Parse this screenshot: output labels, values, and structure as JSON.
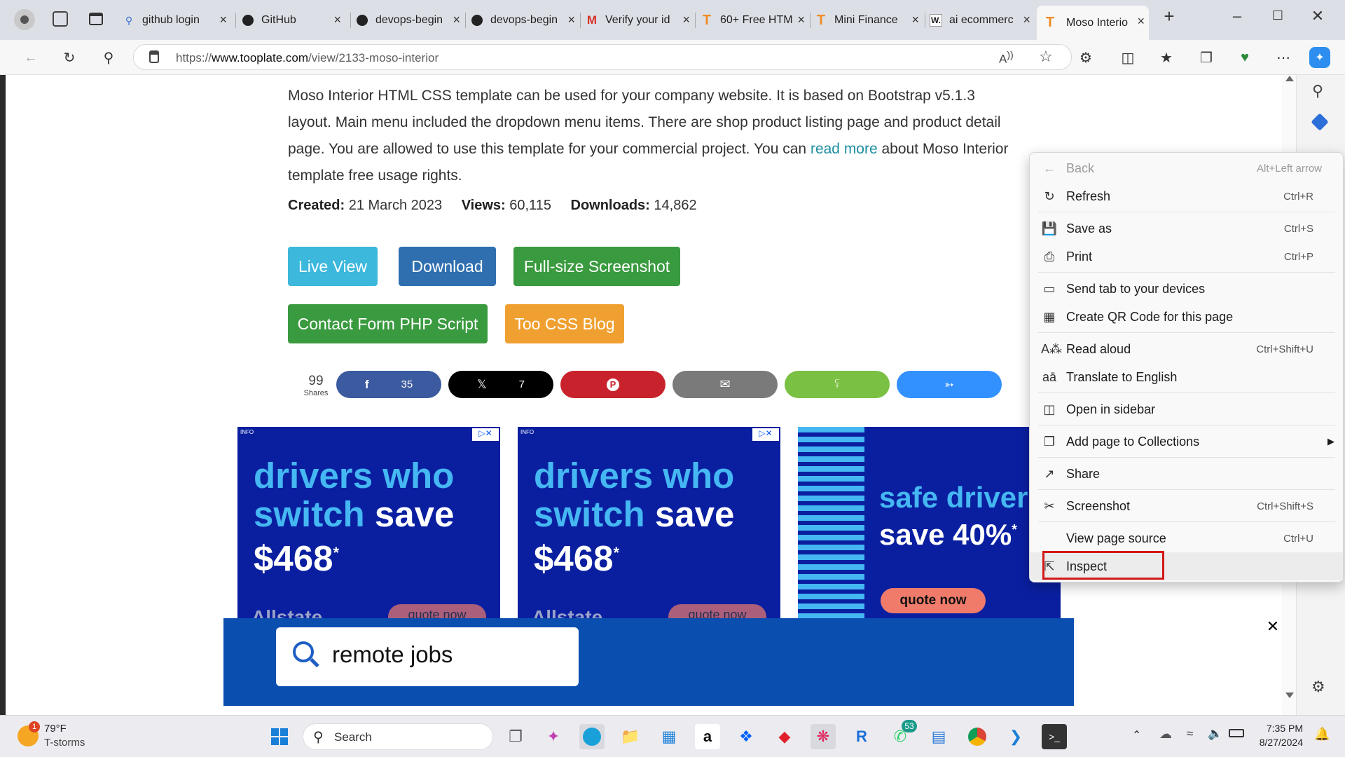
{
  "browser": {
    "tabs": [
      {
        "title": "github login",
        "favicon": "search-icon"
      },
      {
        "title": "GitHub",
        "favicon": "github-icon"
      },
      {
        "title": "devops-begin",
        "favicon": "github-icon"
      },
      {
        "title": "devops-begin",
        "favicon": "github-icon"
      },
      {
        "title": "Verify your id",
        "favicon": "gmail-icon"
      },
      {
        "title": "60+ Free HTM",
        "favicon": "tooplate-icon"
      },
      {
        "title": "Mini Finance",
        "favicon": "tooplate-icon"
      },
      {
        "title": "ai ecommerc",
        "favicon": "w-icon"
      },
      {
        "title": "Moso Interio",
        "favicon": "tooplate-icon",
        "active": true
      }
    ],
    "url_prefix": "https://",
    "url_host": "www.tooplate.com",
    "url_path": "/view/2133-moso-interior"
  },
  "page": {
    "description_1": "Moso Interior HTML CSS template can be used for your company website. It is based on Bootstrap v5.1.3 layout. Main menu included the dropdown menu items. There are shop product listing page and product detail page. You are allowed to use this template for your commercial project. You can ",
    "description_link": "read more",
    "description_2": " about Moso Interior template free usage rights.",
    "created_label": "Created:",
    "created_value": "21 March 2023",
    "views_label": "Views:",
    "views_value": "60,115",
    "downloads_label": "Downloads:",
    "downloads_value": "14,862",
    "buttons": {
      "live_view": "Live View",
      "download": "Download",
      "screenshot": "Full-size Screenshot",
      "contact_form": "Contact Form PHP Script",
      "blog": "Too CSS Blog"
    },
    "share": {
      "total": "99",
      "total_label": "Shares",
      "facebook_count": "35",
      "x_count": "7"
    },
    "ads": [
      {
        "info": "INFO",
        "line1": "drivers who",
        "line2a": "switch",
        "line2b": "save",
        "line3": "$468",
        "sup": "*",
        "brand": "Allstate",
        "cta": "quote now"
      },
      {
        "info": "INFO",
        "line1": "drivers who",
        "line2a": "switch",
        "line2b": "save",
        "line3": "$468",
        "sup": "*",
        "brand": "Allstate",
        "cta": "quote now"
      },
      {
        "line1": "safe driver",
        "line2": "save 40%",
        "sup": "*",
        "cta": "quote now"
      }
    ],
    "bottom_ad": {
      "query": "remote jobs"
    }
  },
  "context_menu": [
    {
      "icon": "back-arrow-icon",
      "label": "Back",
      "shortcut": "Alt+Left arrow",
      "disabled": true
    },
    {
      "icon": "refresh-icon",
      "label": "Refresh",
      "shortcut": "Ctrl+R"
    },
    {
      "icon": "save-icon",
      "label": "Save as",
      "shortcut": "Ctrl+S"
    },
    {
      "icon": "print-icon",
      "label": "Print",
      "shortcut": "Ctrl+P"
    },
    {
      "icon": "send-tab-icon",
      "label": "Send tab to your devices",
      "shortcut": ""
    },
    {
      "icon": "qr-code-icon",
      "label": "Create QR Code for this page",
      "shortcut": ""
    },
    {
      "icon": "read-aloud-icon",
      "label": "Read aloud",
      "shortcut": "Ctrl+Shift+U"
    },
    {
      "icon": "translate-icon",
      "label": "Translate to English",
      "shortcut": ""
    },
    {
      "icon": "sidebar-icon",
      "label": "Open in sidebar",
      "shortcut": ""
    },
    {
      "icon": "collections-icon",
      "label": "Add page to Collections",
      "shortcut": "",
      "submenu": true
    },
    {
      "icon": "share-icon",
      "label": "Share",
      "shortcut": ""
    },
    {
      "icon": "screenshot-icon",
      "label": "Screenshot",
      "shortcut": "Ctrl+Shift+S"
    },
    {
      "icon": "",
      "label": "View page source",
      "shortcut": "Ctrl+U"
    },
    {
      "icon": "inspect-icon",
      "label": "Inspect",
      "shortcut": "",
      "highlighted": true
    }
  ],
  "taskbar": {
    "weather_temp": "79°F",
    "weather_desc": "T-storms",
    "weather_badge": "1",
    "search_label": "Search",
    "whatsapp_badge": "53",
    "time": "7:35 PM",
    "date": "8/27/2024"
  },
  "colors": {
    "live_view": "#3cb8dc",
    "download": "#2f6faf",
    "screenshot": "#3a9a3f",
    "contact_form": "#3a9a3f",
    "blog": "#f0a030",
    "facebook": "#3b5aa0",
    "x": "#000000",
    "pinterest": "#c8232c",
    "email": "#7a7a7a",
    "sharethis": "#7ac043",
    "messenger": "#3391ff",
    "inspect_outline": "#d41818"
  }
}
